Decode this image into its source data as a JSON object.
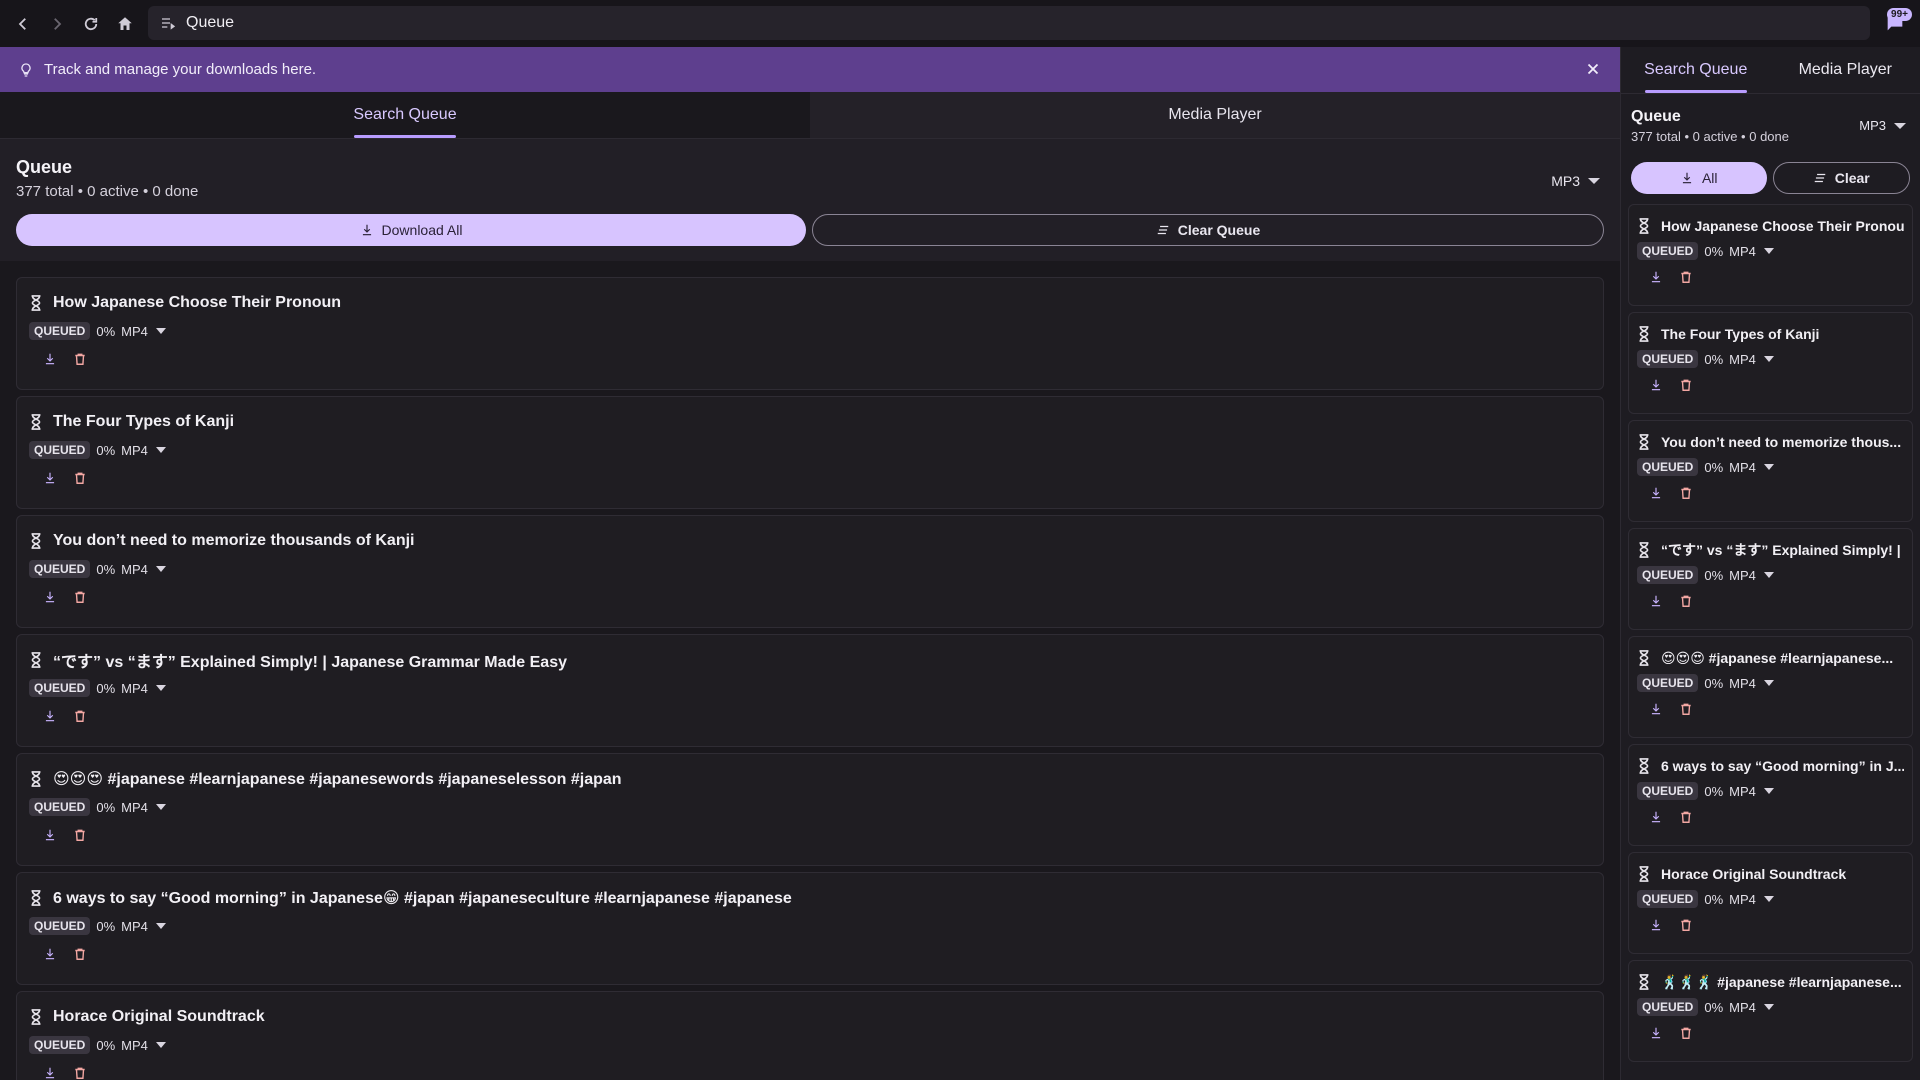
{
  "browser": {
    "address_text": "Queue",
    "ext_badge": "99+"
  },
  "banner": {
    "text": "Track and manage your downloads here."
  },
  "tabs": {
    "search_queue": "Search Queue",
    "media_player": "Media Player"
  },
  "queue": {
    "title": "Queue",
    "stats": "377 total • 0 active • 0 done",
    "format": "MP3",
    "download_all": "Download All",
    "clear_queue": "Clear Queue"
  },
  "side": {
    "tab_search_queue": "Search Queue",
    "tab_media_player": "Media Player",
    "title": "Queue",
    "stats": "377 total • 0 active • 0 done",
    "format": "MP3",
    "all_label": "All",
    "clear_label": "Clear"
  },
  "items": [
    {
      "title": "How Japanese Choose Their Pronoun",
      "status": "QUEUED",
      "progress": "0%",
      "format": "MP4"
    },
    {
      "title": "The Four Types of Kanji",
      "status": "QUEUED",
      "progress": "0%",
      "format": "MP4"
    },
    {
      "title": "You don’t need to memorize thousands of Kanji",
      "status": "QUEUED",
      "progress": "0%",
      "format": "MP4"
    },
    {
      "title": "“です” vs “ます” Explained Simply! | Japanese Grammar Made Easy",
      "status": "QUEUED",
      "progress": "0%",
      "format": "MP4"
    },
    {
      "title": "😍😍😍 #japanese #learnjapanese #japanesewords #japaneselesson #japan",
      "status": "QUEUED",
      "progress": "0%",
      "format": "MP4"
    },
    {
      "title": "6 ways to say “Good morning” in Japanese😁 #japan #japaneseculture #learnjapanese #japanese",
      "status": "QUEUED",
      "progress": "0%",
      "format": "MP4"
    },
    {
      "title": "Horace Original Soundtrack",
      "status": "QUEUED",
      "progress": "0%",
      "format": "MP4"
    }
  ],
  "side_items": [
    {
      "title": "How Japanese Choose Their Pronoun",
      "status": "QUEUED",
      "progress": "0%",
      "format": "MP4"
    },
    {
      "title": "The Four Types of Kanji",
      "status": "QUEUED",
      "progress": "0%",
      "format": "MP4"
    },
    {
      "title": "You don’t need to memorize thous...",
      "status": "QUEUED",
      "progress": "0%",
      "format": "MP4"
    },
    {
      "title": "“です” vs “ます” Explained Simply! | J...",
      "status": "QUEUED",
      "progress": "0%",
      "format": "MP4"
    },
    {
      "title": "😍😍😍 #japanese #learnjapanese...",
      "status": "QUEUED",
      "progress": "0%",
      "format": "MP4"
    },
    {
      "title": "6 ways to say “Good morning” in J...",
      "status": "QUEUED",
      "progress": "0%",
      "format": "MP4"
    },
    {
      "title": "Horace Original Soundtrack",
      "status": "QUEUED",
      "progress": "0%",
      "format": "MP4"
    },
    {
      "title": "🕺🕺🕺 #japanese #learnjapanese...",
      "status": "QUEUED",
      "progress": "0%",
      "format": "MP4"
    }
  ]
}
